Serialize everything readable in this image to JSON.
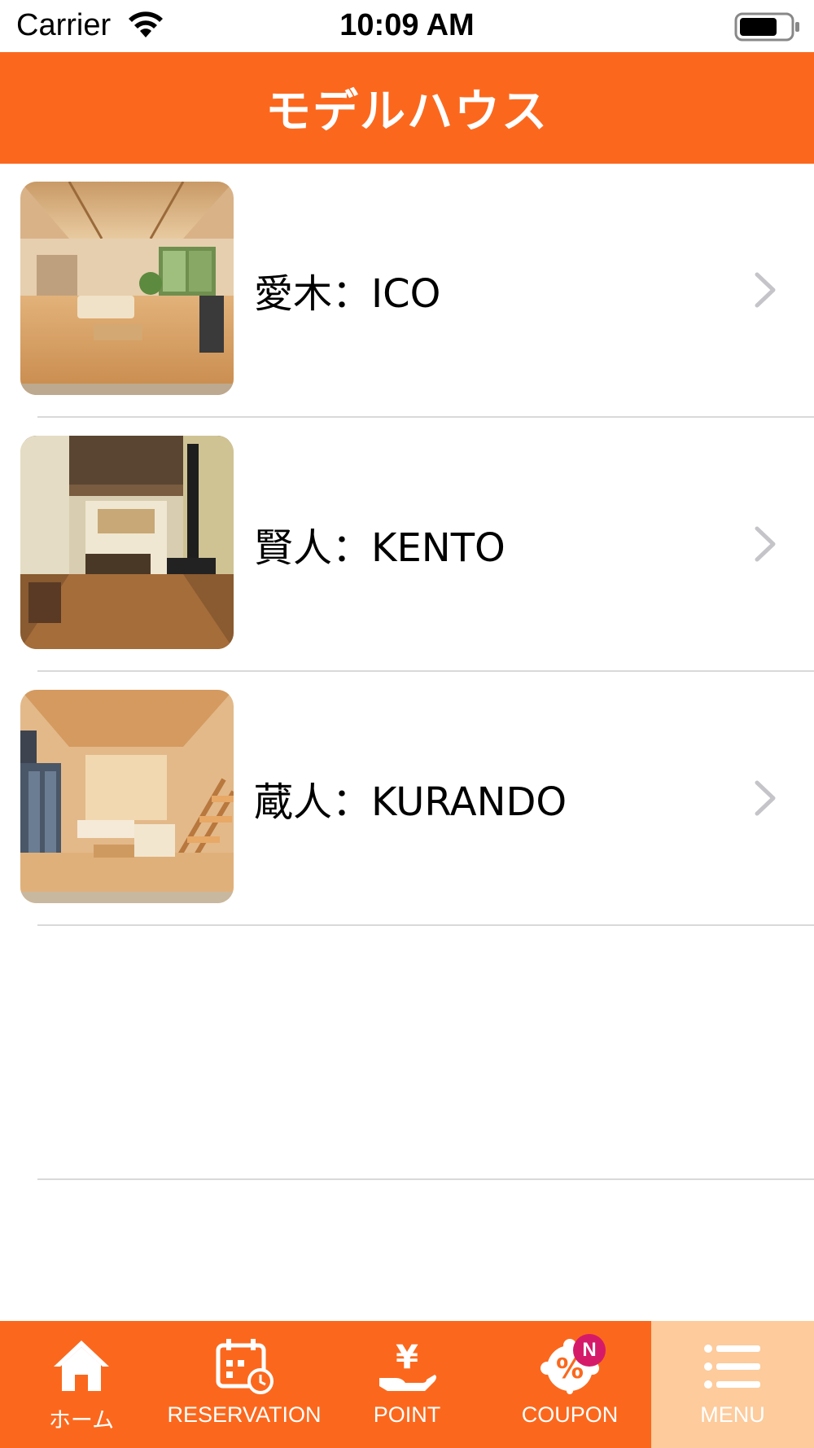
{
  "status_bar": {
    "carrier": "Carrier",
    "time": "10:09 AM",
    "wifi_icon": "wifi-icon",
    "battery_icon": "battery-icon"
  },
  "nav": {
    "title": "モデルハウス",
    "background_color": "#fb681d"
  },
  "list": {
    "items": [
      {
        "label": "愛木：ICO",
        "thumbnail": "living-room-photo",
        "accessory": "chevron-right-icon"
      },
      {
        "label": "賢人：KENTO",
        "thumbnail": "wood-stove-room-photo",
        "accessory": "chevron-right-icon"
      },
      {
        "label": "蔵人：KURANDO",
        "thumbnail": "staircase-living-photo",
        "accessory": "chevron-right-icon"
      }
    ]
  },
  "tab_bar": {
    "background_color": "#fb681d",
    "active_color": "#fdcb9c",
    "tabs": [
      {
        "label": "ホーム",
        "icon": "home-icon"
      },
      {
        "label": "RESERVATION",
        "icon": "calendar-clock-icon"
      },
      {
        "label": "POINT",
        "icon": "yen-hand-icon"
      },
      {
        "label": "COUPON",
        "icon": "percent-badge-icon",
        "badge": "N"
      },
      {
        "label": "MENU",
        "icon": "menu-list-icon",
        "active": true
      }
    ]
  }
}
